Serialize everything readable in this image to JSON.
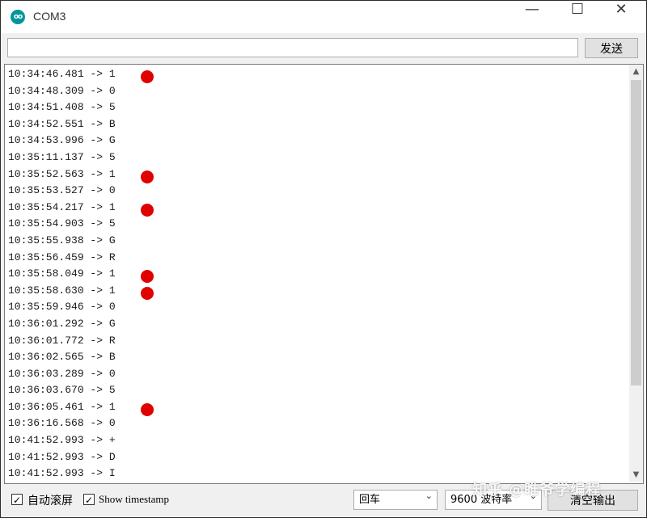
{
  "window": {
    "title": "COM3",
    "icon_text": "oo",
    "minimize_glyph": "—",
    "maximize_glyph": "☐",
    "close_glyph": "✕"
  },
  "toolbar": {
    "input_value": "",
    "send_label": "发送"
  },
  "serial_output": {
    "lines": [
      "10:34:46.481 -> 1",
      "10:34:48.309 -> 0",
      "10:34:51.408 -> 5",
      "10:34:52.551 -> B",
      "10:34:53.996 -> G",
      "10:35:11.137 -> 5",
      "10:35:52.563 -> 1",
      "10:35:53.527 -> 0",
      "10:35:54.217 -> 1",
      "10:35:54.903 -> 5",
      "10:35:55.938 -> G",
      "10:35:56.459 -> R",
      "10:35:58.049 -> 1",
      "10:35:58.630 -> 1",
      "10:35:59.946 -> 0",
      "10:36:01.292 -> G",
      "10:36:01.772 -> R",
      "10:36:02.565 -> B",
      "10:36:03.289 -> 0",
      "10:36:03.670 -> 5",
      "10:36:05.461 -> 1",
      "10:36:16.568 -> 0",
      "10:41:52.993 -> +",
      "10:41:52.993 -> D",
      "10:41:52.993 -> I"
    ],
    "marked_line_indices": [
      0,
      6,
      8,
      12,
      13,
      20
    ],
    "marker_color": "#e00000"
  },
  "statusbar": {
    "autoscroll_label": "自动滚屏",
    "autoscroll_checked": true,
    "timestamp_label": "Show timestamp",
    "timestamp_checked": true,
    "line_ending_value": "回车",
    "baud_value": "9600 波特率",
    "clear_label": "清空输出"
  },
  "watermark": "知乎 @睢爷学编程",
  "colors": {
    "accent": "#00979c",
    "marker": "#e00000"
  }
}
